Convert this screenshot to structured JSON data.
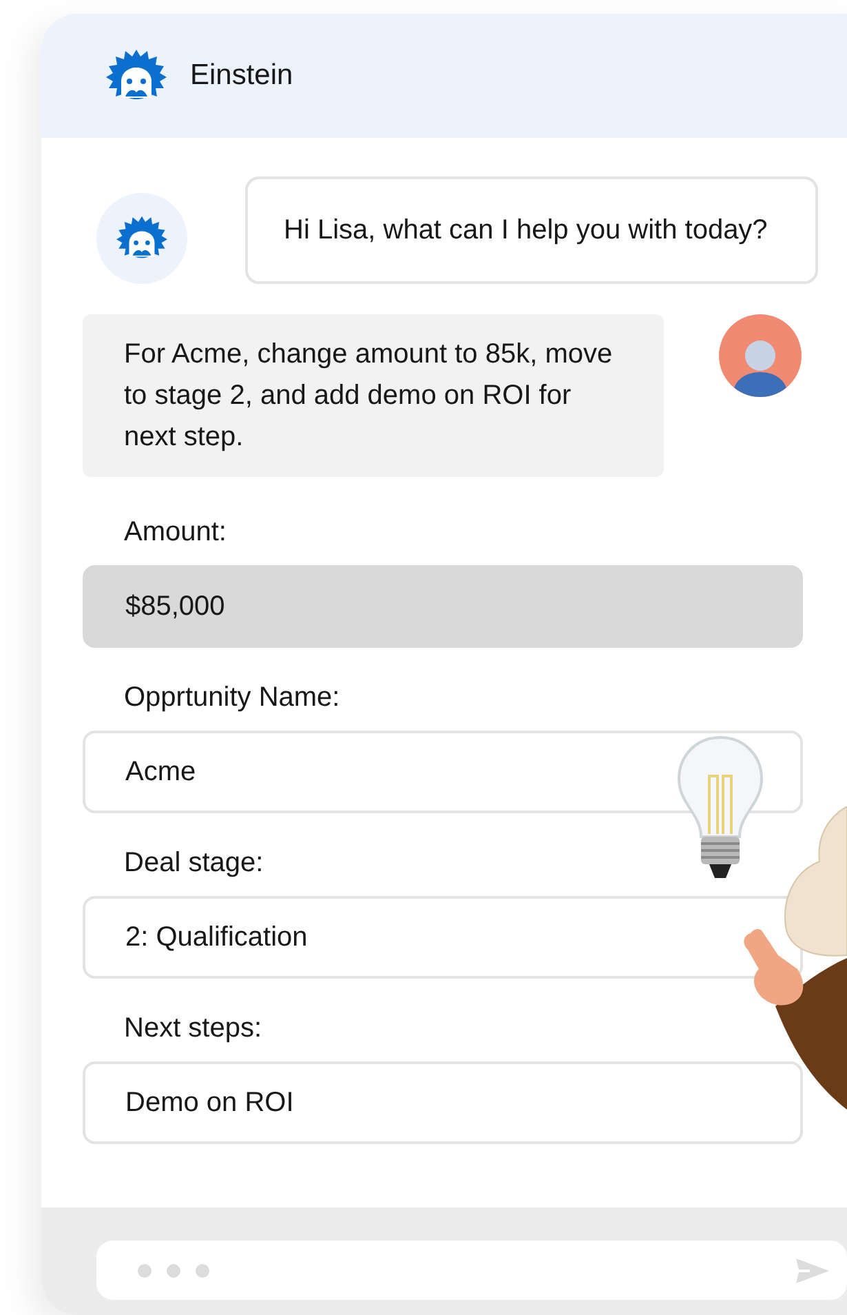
{
  "header": {
    "title": "Einstein"
  },
  "messages": [
    {
      "kind": "bot",
      "text": "Hi Lisa, what can I help you with today?"
    },
    {
      "kind": "user",
      "text": "For Acme, change amount to 85k, move to stage 2, and add demo on ROI for next step."
    }
  ],
  "fields": [
    {
      "label": "Amount:",
      "value": "$85,000",
      "highlighted": true
    },
    {
      "label": "Opprtunity Name:",
      "value": "Acme",
      "highlighted": false
    },
    {
      "label": "Deal stage:",
      "value": "2: Qualification",
      "highlighted": false
    },
    {
      "label": "Next steps:",
      "value": "Demo on ROI",
      "highlighted": false
    }
  ],
  "composer": {
    "typing": true
  }
}
